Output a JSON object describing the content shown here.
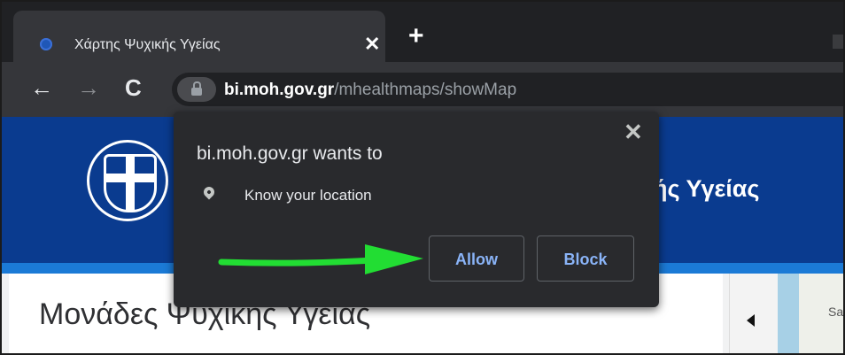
{
  "browser": {
    "tab": {
      "title": "Χάρτης Ψυχικής Υγείας",
      "close_glyph": "✕"
    },
    "new_tab_glyph": "+",
    "nav": {
      "back_glyph": "←",
      "forward_glyph": "→",
      "reload_glyph": "C"
    },
    "address": {
      "host": "bi.moh.gov.gr",
      "path": "/mhealthmaps/showMap"
    }
  },
  "site": {
    "header_title": "ής Υγείας",
    "page_heading": "Μονάδες Ψυχικής Υγείας",
    "map_label": "Sa",
    "colors": {
      "header": "#0a3b8f",
      "band": "#1b7ad6"
    }
  },
  "permission_prompt": {
    "title": "bi.moh.gov.gr wants to",
    "permission": "Know your location",
    "close_glyph": "✕",
    "allow_label": "Allow",
    "block_label": "Block",
    "button_color": "#8ab4f8"
  },
  "annotation": {
    "arrow_color": "#22dd33"
  }
}
